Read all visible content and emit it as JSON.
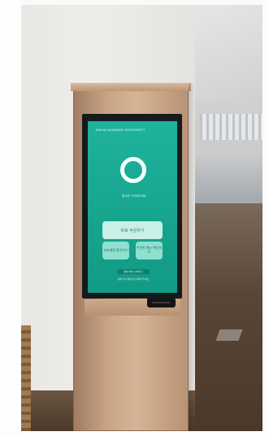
{
  "kiosk": {
    "screen": {
      "header": "EWHA WOMANS UNIVERSITY",
      "caption": "잠시만 기다려주세요",
      "primary_button": "바로 주문하기",
      "secondary_buttons": [
        "자리배정 확인하기",
        "주문한 메뉴 확인하기"
      ],
      "pill_button": "결제 방법 선택하기",
      "footer": "원하시는 메뉴를 선택해 주세요"
    }
  }
}
